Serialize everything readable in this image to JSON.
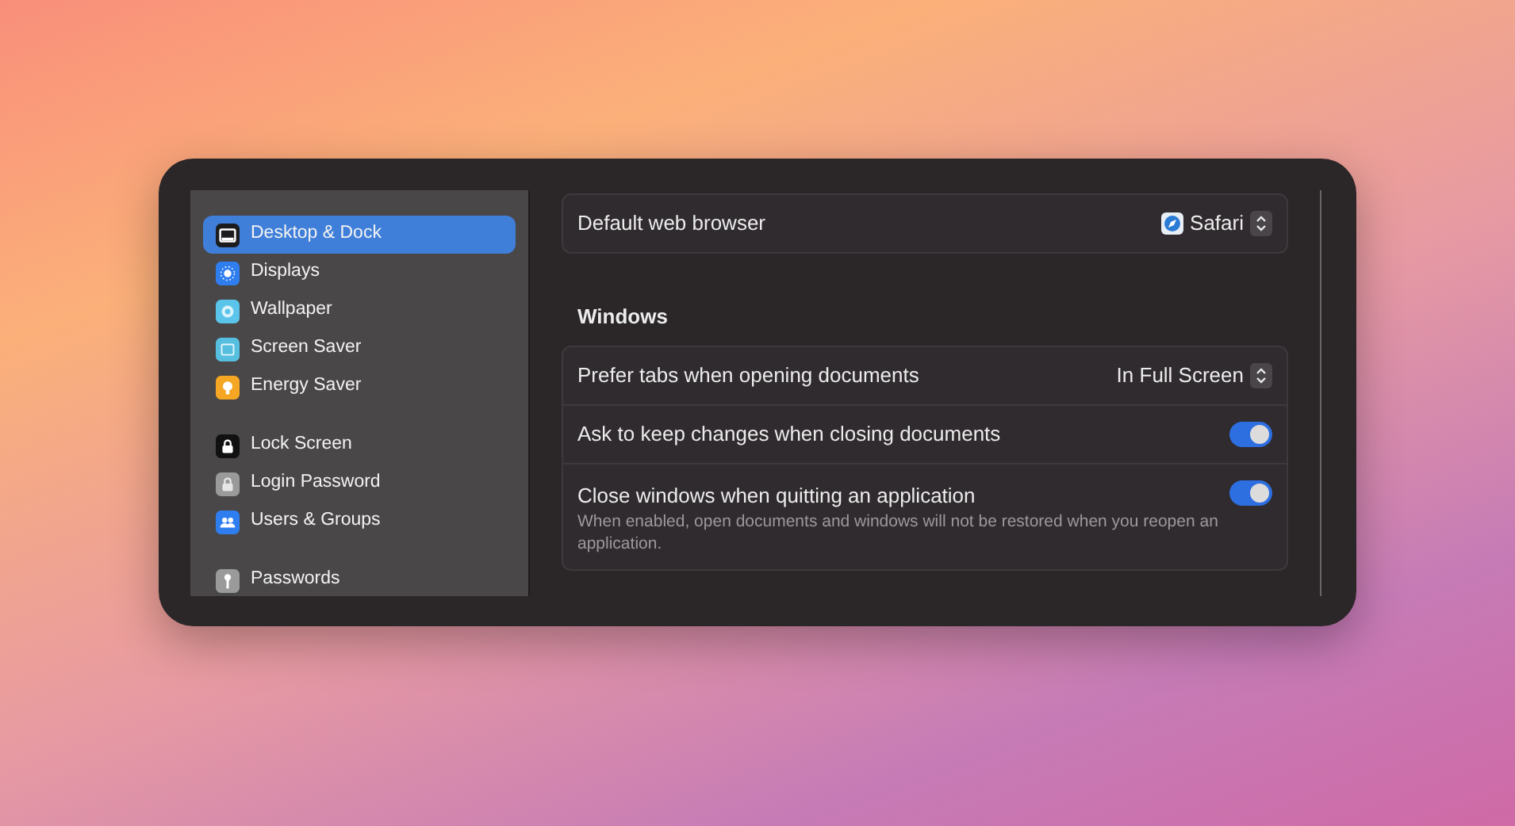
{
  "sidebar": {
    "groups": [
      {
        "items": [
          {
            "label": "Desktop & Dock",
            "kind": "dock",
            "color": "#1c1c1e",
            "selected": true
          },
          {
            "label": "Displays",
            "kind": "display",
            "color": "#2f7ef0",
            "selected": false
          },
          {
            "label": "Wallpaper",
            "kind": "wallpaper",
            "color": "#5bc4ea",
            "selected": false
          },
          {
            "label": "Screen Saver",
            "kind": "screensaver",
            "color": "#56bfe0",
            "selected": false
          },
          {
            "label": "Energy Saver",
            "kind": "energy",
            "color": "#f5a623",
            "selected": false
          }
        ]
      },
      {
        "items": [
          {
            "label": "Lock Screen",
            "kind": "lock",
            "color": "#111111",
            "selected": false
          },
          {
            "label": "Login Password",
            "kind": "login",
            "color": "#9a9a9a",
            "selected": false
          },
          {
            "label": "Users & Groups",
            "kind": "users",
            "color": "#2f7ef0",
            "selected": false
          }
        ]
      },
      {
        "items": [
          {
            "label": "Passwords",
            "kind": "key",
            "color": "#9a9a9a",
            "selected": false
          }
        ]
      }
    ]
  },
  "browser_card": {
    "rows": [
      {
        "kind": "popup",
        "label": "Default web browser",
        "value": "Safari",
        "app_icon": true
      }
    ]
  },
  "windows_section": {
    "title": "Windows",
    "rows": [
      {
        "kind": "popup",
        "label": "Prefer tabs when opening documents",
        "value": "In Full Screen",
        "app_icon": false
      },
      {
        "kind": "toggle",
        "label": "Ask to keep changes when closing documents",
        "on": true
      },
      {
        "kind": "toggle",
        "label": "Close windows when quitting an application",
        "on": true,
        "note": "When enabled, open documents and windows will not be restored when you reopen an application."
      }
    ]
  }
}
